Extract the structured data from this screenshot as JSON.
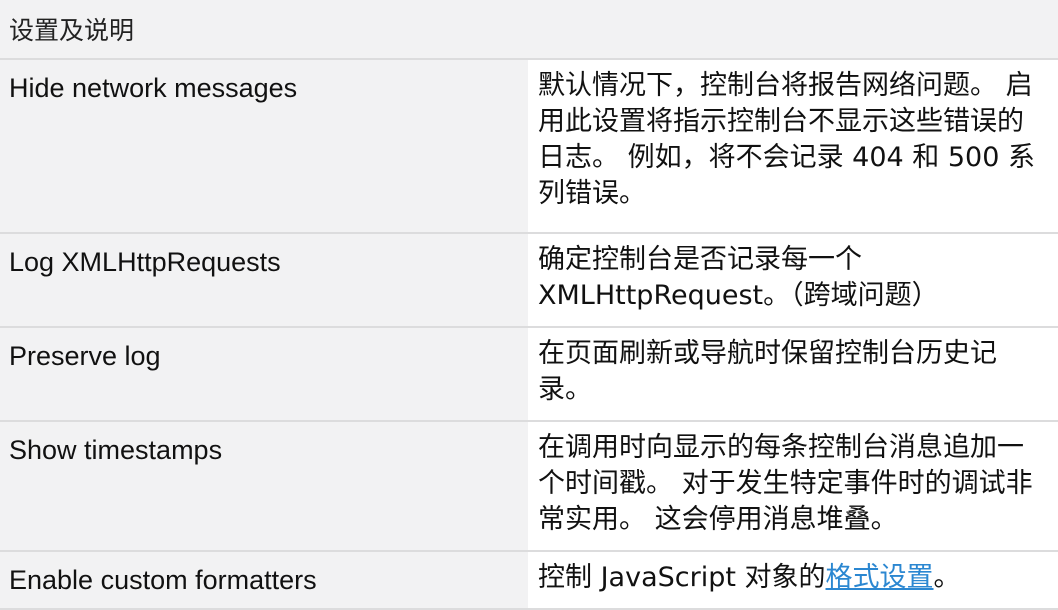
{
  "table": {
    "header": "设置及说明",
    "rows": [
      {
        "name": "Hide network messages",
        "description": "默认情况下，控制台将报告网络问题。 启用此设置将指示控制台不显示这些错误的日志。 例如，将不会记录 404 和 500 系列错误。"
      },
      {
        "name": "Log XMLHttpRequests",
        "description": "确定控制台是否记录每一个 XMLHttpRequest。（跨域问题）"
      },
      {
        "name": "Preserve log",
        "description": "在页面刷新或导航时保留控制台历史记录。"
      },
      {
        "name": "Show timestamps",
        "description": "在调用时向显示的每条控制台消息追加一个时间戳。 对于发生特定事件时的调试非常实用。 这会停用消息堆叠。"
      },
      {
        "name": "Enable custom formatters",
        "description_prefix": "控制 JavaScript 对象的",
        "description_link": "格式设置",
        "description_suffix": "。"
      }
    ]
  },
  "colors": {
    "header_bg": "#f2f2f3",
    "name_bg": "#f2f2f3",
    "desc_bg": "#ffffff",
    "border": "#dcdcdd",
    "link": "#2b87d1"
  }
}
